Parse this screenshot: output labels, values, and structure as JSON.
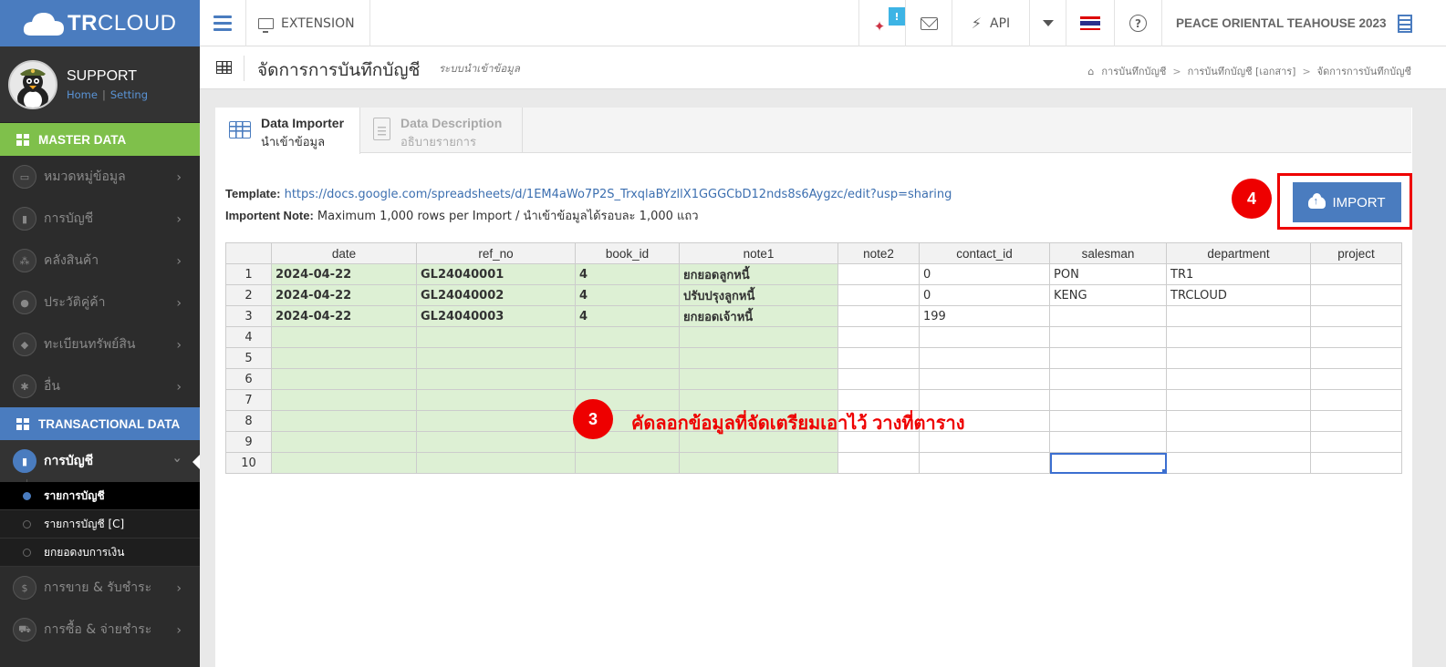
{
  "app": {
    "brand_bold": "TR",
    "brand_light": "CLOUD"
  },
  "user": {
    "name": "SUPPORT",
    "home_link": "Home",
    "setting_link": "Setting",
    "separator": "|"
  },
  "sidebar": {
    "master_header": "MASTER DATA",
    "master_items": [
      {
        "label": "หมวดหมู่ข้อมูล",
        "icon": "book-open-icon"
      },
      {
        "label": "การบัญชี",
        "icon": "book-icon"
      },
      {
        "label": "คลังสินค้า",
        "icon": "cubes-icon"
      },
      {
        "label": "ประวัติคู่ค้า",
        "icon": "user-icon"
      },
      {
        "label": "ทะเบียนทรัพย์สิน",
        "icon": "diamond-icon"
      },
      {
        "label": "อื่น",
        "icon": "cog-icon"
      }
    ],
    "trans_header": "TRANSACTIONAL DATA",
    "active_item": "การบัญชี",
    "sub_items": [
      "รายการบัญชี",
      "รายการบัญชี [C]",
      "ยกยอดงบการเงิน"
    ],
    "trans_items": [
      {
        "label": "การขาย & รับชำระ",
        "icon": "dollar-icon"
      },
      {
        "label": "การซื้อ & จ่ายชำระ",
        "icon": "cart-icon"
      }
    ]
  },
  "topbar": {
    "extension_label": "EXTENSION",
    "badge": "!",
    "api_label": "API",
    "company": "PEACE ORIENTAL TEAHOUSE 2023"
  },
  "page": {
    "title": "จัดการการบันทึกบัญชี",
    "subtitle": "ระบบนำเข้าข้อมูล",
    "breadcrumb": [
      "การบันทึกบัญชี",
      "การบันทึกบัญชี [เอกสาร]",
      "จัดการการบันทึกบัญชี"
    ]
  },
  "tabs": [
    {
      "label": "Data Importer",
      "sublabel": "นำเข้าข้อมูล"
    },
    {
      "label": "Data Description",
      "sublabel": "อธิบายรายการ"
    }
  ],
  "info": {
    "template_label": "Template:",
    "template_url": "https://docs.google.com/spreadsheets/d/1EM4aWo7P2S_TrxqlaBYzllX1GGGCbD12nds8s6Aygzc/edit?usp=sharing",
    "note_label": "Importent Note:",
    "note_text": "Maximum 1,000 rows per Import / นำเข้าข้อมูลได้รอบละ 1,000 แถว"
  },
  "import_button": "IMPORT",
  "annotations": {
    "step3_number": "3",
    "step3_text": "คัดลอกข้อมูลที่จัดเตรียมเอาไว้ วางที่ตาราง",
    "step4_number": "4"
  },
  "sheet": {
    "columns": [
      "date",
      "ref_no",
      "book_id",
      "note1",
      "note2",
      "contact_id",
      "salesman",
      "department",
      "project"
    ],
    "rows": [
      {
        "n": "1",
        "cells": [
          "2024-04-22",
          "GL24040001",
          "4",
          "ยกยอดลูกหนี้",
          "",
          "0",
          "PON",
          "TR1",
          ""
        ]
      },
      {
        "n": "2",
        "cells": [
          "2024-04-22",
          "GL24040002",
          "4",
          "ปรับปรุงลูกหนี้",
          "",
          "0",
          "KENG",
          "TRCLOUD",
          ""
        ]
      },
      {
        "n": "3",
        "cells": [
          "2024-04-22",
          "GL24040003",
          "4",
          "ยกยอดเจ้าหนี้",
          "",
          "199",
          "",
          "",
          ""
        ]
      },
      {
        "n": "4",
        "cells": [
          "",
          "",
          "",
          "",
          "",
          "",
          "",
          "",
          ""
        ]
      },
      {
        "n": "5",
        "cells": [
          "",
          "",
          "",
          "",
          "",
          "",
          "",
          "",
          ""
        ]
      },
      {
        "n": "6",
        "cells": [
          "",
          "",
          "",
          "",
          "",
          "",
          "",
          "",
          ""
        ]
      },
      {
        "n": "7",
        "cells": [
          "",
          "",
          "",
          "",
          "",
          "",
          "",
          "",
          ""
        ]
      },
      {
        "n": "8",
        "cells": [
          "",
          "",
          "",
          "",
          "",
          "",
          "",
          "",
          ""
        ]
      },
      {
        "n": "9",
        "cells": [
          "",
          "",
          "",
          "",
          "",
          "",
          "",
          "",
          ""
        ]
      },
      {
        "n": "10",
        "cells": [
          "",
          "",
          "",
          "",
          "",
          "",
          "",
          "",
          ""
        ]
      }
    ]
  },
  "colors": {
    "primary": "#4a7cbf",
    "master_green": "#7fc04b",
    "required_cell": "#ddf0d4",
    "annotation_red": "#e00000"
  }
}
